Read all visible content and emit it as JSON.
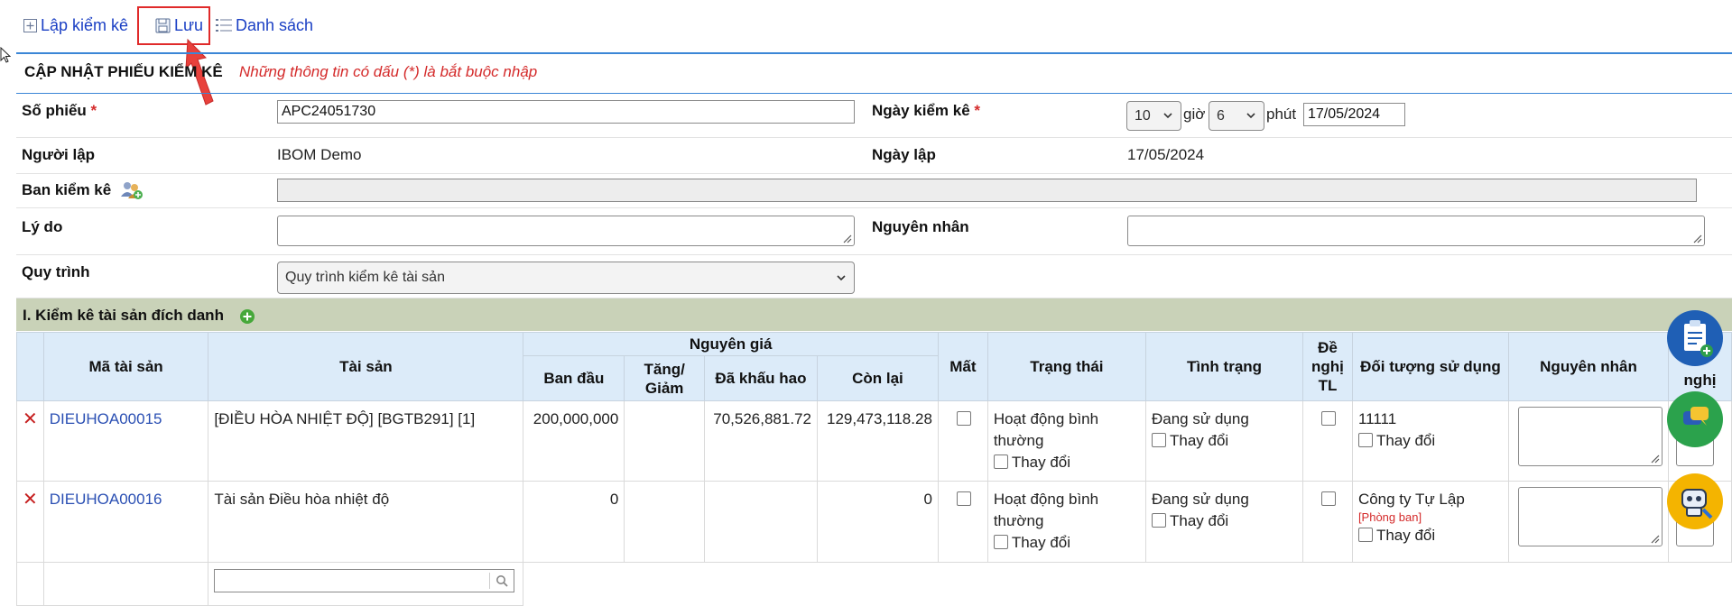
{
  "toolbar": {
    "create_label": "Lập kiểm kê",
    "save_label": "Lưu",
    "list_label": "Danh sách"
  },
  "section": {
    "title": "CẬP NHẬT PHIẾU KIỂM KÊ",
    "note": "Những thông tin có dấu (*) là bắt buộc nhập"
  },
  "form": {
    "so_phieu_label": "Số phiếu",
    "so_phieu_value": "APC24051730",
    "ngay_kiem_ke_label": "Ngày kiểm kê",
    "hour_value": "10",
    "hour_unit": "giờ",
    "minute_value": "6",
    "minute_unit": "phút",
    "date_value": "17/05/2024",
    "nguoi_lap_label": "Người lập",
    "nguoi_lap_value": "IBOM Demo",
    "ngay_lap_label": "Ngày lập",
    "ngay_lap_value": "17/05/2024",
    "ban_kiem_ke_label": "Ban kiểm kê",
    "ly_do_label": "Lý do",
    "nguyen_nhan_label": "Nguyên nhân",
    "quy_trinh_label": "Quy trình",
    "quy_trinh_value": "Quy trình kiểm kê tài sản",
    "required_mark": "*"
  },
  "group": {
    "title": "I. Kiểm kê tài sản đích danh"
  },
  "table": {
    "headers": {
      "ma_tai_san": "Mã tài sản",
      "tai_san": "Tài sản",
      "nguyen_gia": "Nguyên giá",
      "ban_dau": "Ban đầu",
      "tang_giam": "Tăng/ Giảm",
      "da_khau_hao": "Đã khấu hao",
      "con_lai": "Còn lại",
      "mat": "Mất",
      "trang_thai": "Trạng thái",
      "tinh_trang": "Tình trạng",
      "de_nghi_tl": "Đề nghị TL",
      "doi_tuong": "Đối tượng sử dụng",
      "nguyen_nhan": "Nguyên nhân",
      "de_nghi_partial": "nghị"
    },
    "rows": [
      {
        "code": "DIEUHOA00015",
        "name": "[ĐIỀU HÒA NHIỆT ĐỘ] [BGTB291] [1]",
        "ban_dau": "200,000,000",
        "tang_giam": "",
        "da_khau_hao": "70,526,881.72",
        "con_lai": "129,473,118.28",
        "trang_thai": "Hoạt động bình thường",
        "tinh_trang": "Đang sử dụng",
        "doi_tuong": "11111",
        "doi_tuong_tag": "",
        "change_label": "Thay đổi"
      },
      {
        "code": "DIEUHOA00016",
        "name": "Tài sản Điều hòa nhiệt độ",
        "ban_dau": "0",
        "tang_giam": "",
        "da_khau_hao": "",
        "con_lai": "0",
        "trang_thai": "Hoạt động bình thường",
        "tinh_trang": "Đang sử dụng",
        "doi_tuong": "Công ty Tự Lập",
        "doi_tuong_tag": "[Phòng ban]",
        "change_label": "Thay đổi"
      }
    ]
  },
  "colors": {
    "accent_blue": "#3b86d6",
    "link_blue": "#1a3fc4",
    "required_red": "#d42a2a",
    "header_bg": "#dcebf9",
    "group_bg": "#c9d2b8",
    "highlight_red": "#e02a2a"
  },
  "icons": {
    "create": "plus-square-icon",
    "save": "floppy-disk-icon",
    "list": "list-icon",
    "team": "team-users-icon",
    "add_row": "green-plus-icon",
    "delete_row": "red-x-icon",
    "search": "search-icon"
  }
}
